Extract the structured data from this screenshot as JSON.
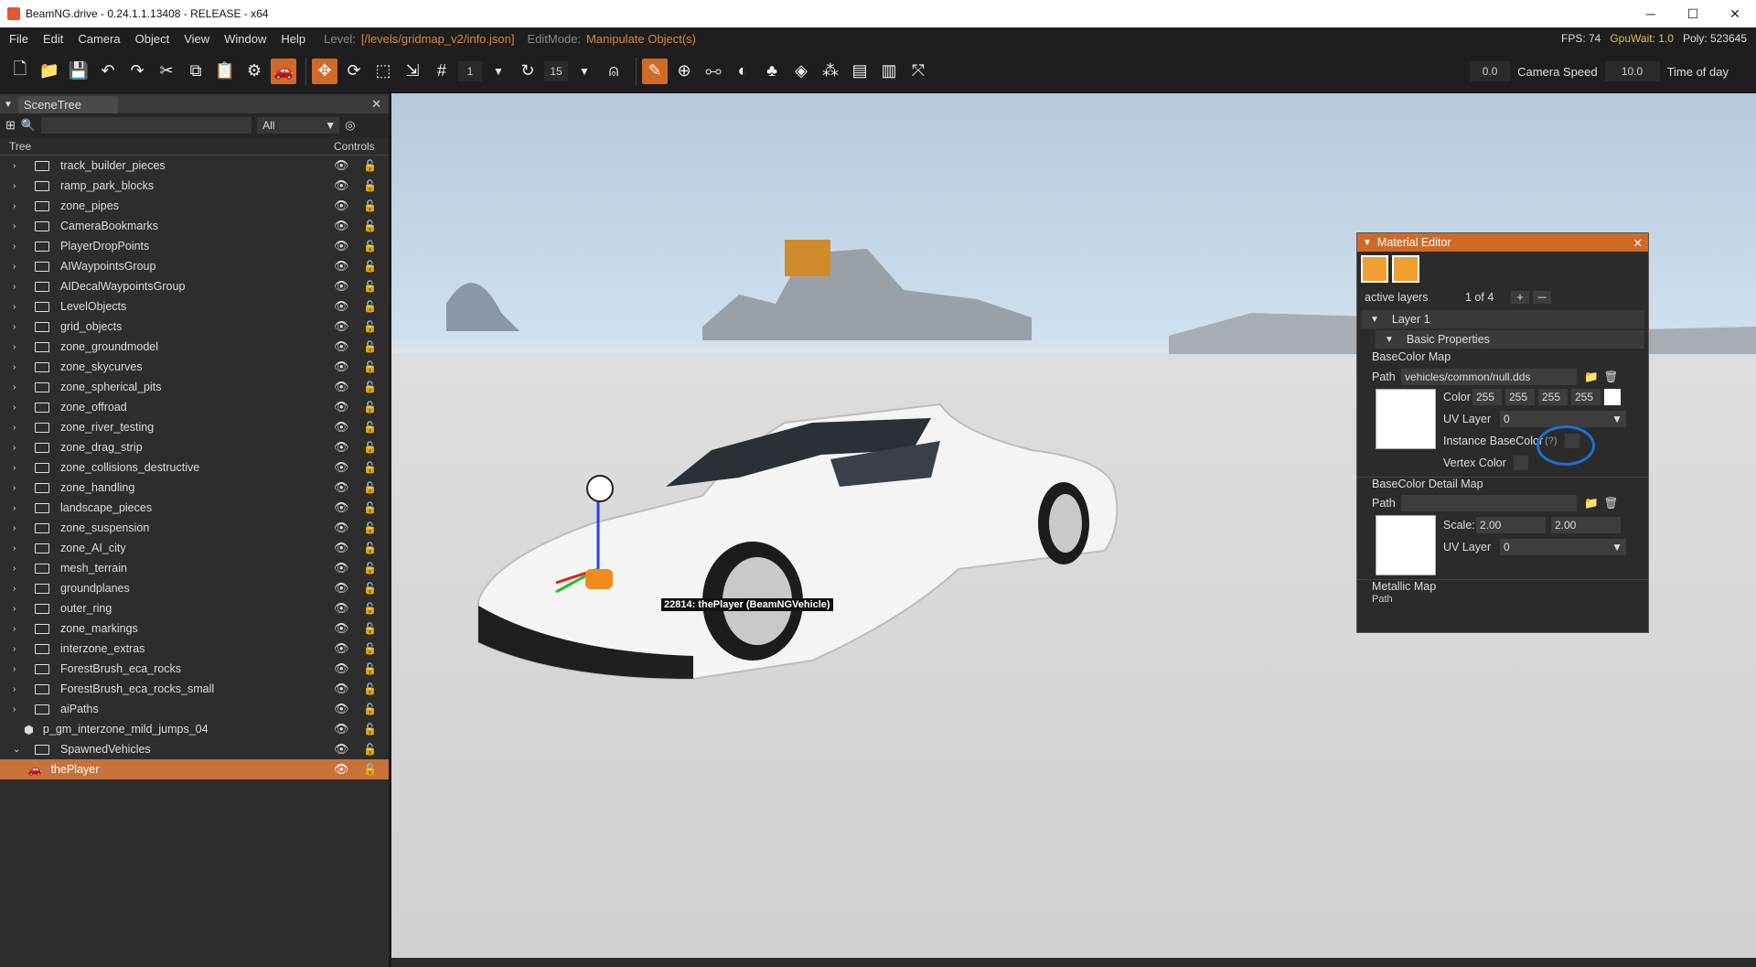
{
  "window": {
    "title": "BeamNG.drive - 0.24.1.1.13408 - RELEASE - x64",
    "minimize": "─",
    "maximize": "☐",
    "close": "✕"
  },
  "menu": {
    "items": [
      "File",
      "Edit",
      "Camera",
      "Object",
      "View",
      "Window",
      "Help"
    ],
    "level_label": "Level:",
    "level_value": "[/levels/gridmap_v2/info.json]",
    "editmode_label": "EditMode:",
    "editmode_value": "Manipulate Object(s)",
    "fps": "FPS: 74",
    "gpuwait": "GpuWait: 1.0",
    "poly": "Poly: 523645"
  },
  "toolbar": {
    "snap_value": "1",
    "rotate_value": "15",
    "field1": "0.0",
    "camera_speed_label": "Camera Speed",
    "camera_speed_value": "10.0",
    "time_label": "Time of day"
  },
  "scenetree": {
    "title": "SceneTree",
    "filter": "All",
    "col_tree": "Tree",
    "col_controls": "Controls",
    "rows": [
      {
        "label": "track_builder_pieces"
      },
      {
        "label": "ramp_park_blocks"
      },
      {
        "label": "zone_pipes"
      },
      {
        "label": "CameraBookmarks"
      },
      {
        "label": "PlayerDropPoints"
      },
      {
        "label": "AIWaypointsGroup"
      },
      {
        "label": "AIDecalWaypointsGroup"
      },
      {
        "label": "LevelObjects"
      },
      {
        "label": "grid_objects"
      },
      {
        "label": "zone_groundmodel"
      },
      {
        "label": "zone_skycurves"
      },
      {
        "label": "zone_spherical_pits"
      },
      {
        "label": "zone_offroad"
      },
      {
        "label": "zone_river_testing"
      },
      {
        "label": "zone_drag_strip"
      },
      {
        "label": "zone_collisions_destructive"
      },
      {
        "label": "zone_handling"
      },
      {
        "label": "landscape_pieces"
      },
      {
        "label": "zone_suspension"
      },
      {
        "label": "zone_AI_city"
      },
      {
        "label": "mesh_terrain"
      },
      {
        "label": "groundplanes"
      },
      {
        "label": "outer_ring"
      },
      {
        "label": "zone_markings"
      },
      {
        "label": "interzone_extras"
      },
      {
        "label": "ForestBrush_eca_rocks"
      },
      {
        "label": "ForestBrush_eca_rocks_small"
      },
      {
        "label": "aiPaths"
      },
      {
        "label": "p_gm_interzone_mild_jumps_04"
      },
      {
        "label": "SpawnedVehicles"
      },
      {
        "label": "thePlayer"
      }
    ]
  },
  "viewport": {
    "object_label": "22814: thePlayer (BeamNGVehicle)"
  },
  "material_editor": {
    "title": "Material Editor",
    "active_layers_label": "active layers",
    "layers_count": "1 of 4",
    "layer": "Layer 1",
    "basic_props": "Basic Properties",
    "basecolor_map": "BaseColor Map",
    "path_label": "Path",
    "path_value": "vehicles/common/null.dds",
    "color_label": "Color",
    "color_values": [
      "255",
      "255",
      "255",
      "255"
    ],
    "uv_layer_label": "UV Layer",
    "uv_value": "0",
    "instance_basecolor": "Instance BaseColor",
    "help": "(?)",
    "vertex_color": "Vertex Color",
    "detail_map": "BaseColor Detail Map",
    "scale_label": "Scale:",
    "scale_values": [
      "2.00",
      "2.00"
    ],
    "uv_value2": "0",
    "metallic_map": "Metallic Map",
    "path_partial": "Path"
  },
  "colors": {
    "accent": "#d06a26",
    "annotation_circle": "#1d6fd8"
  }
}
